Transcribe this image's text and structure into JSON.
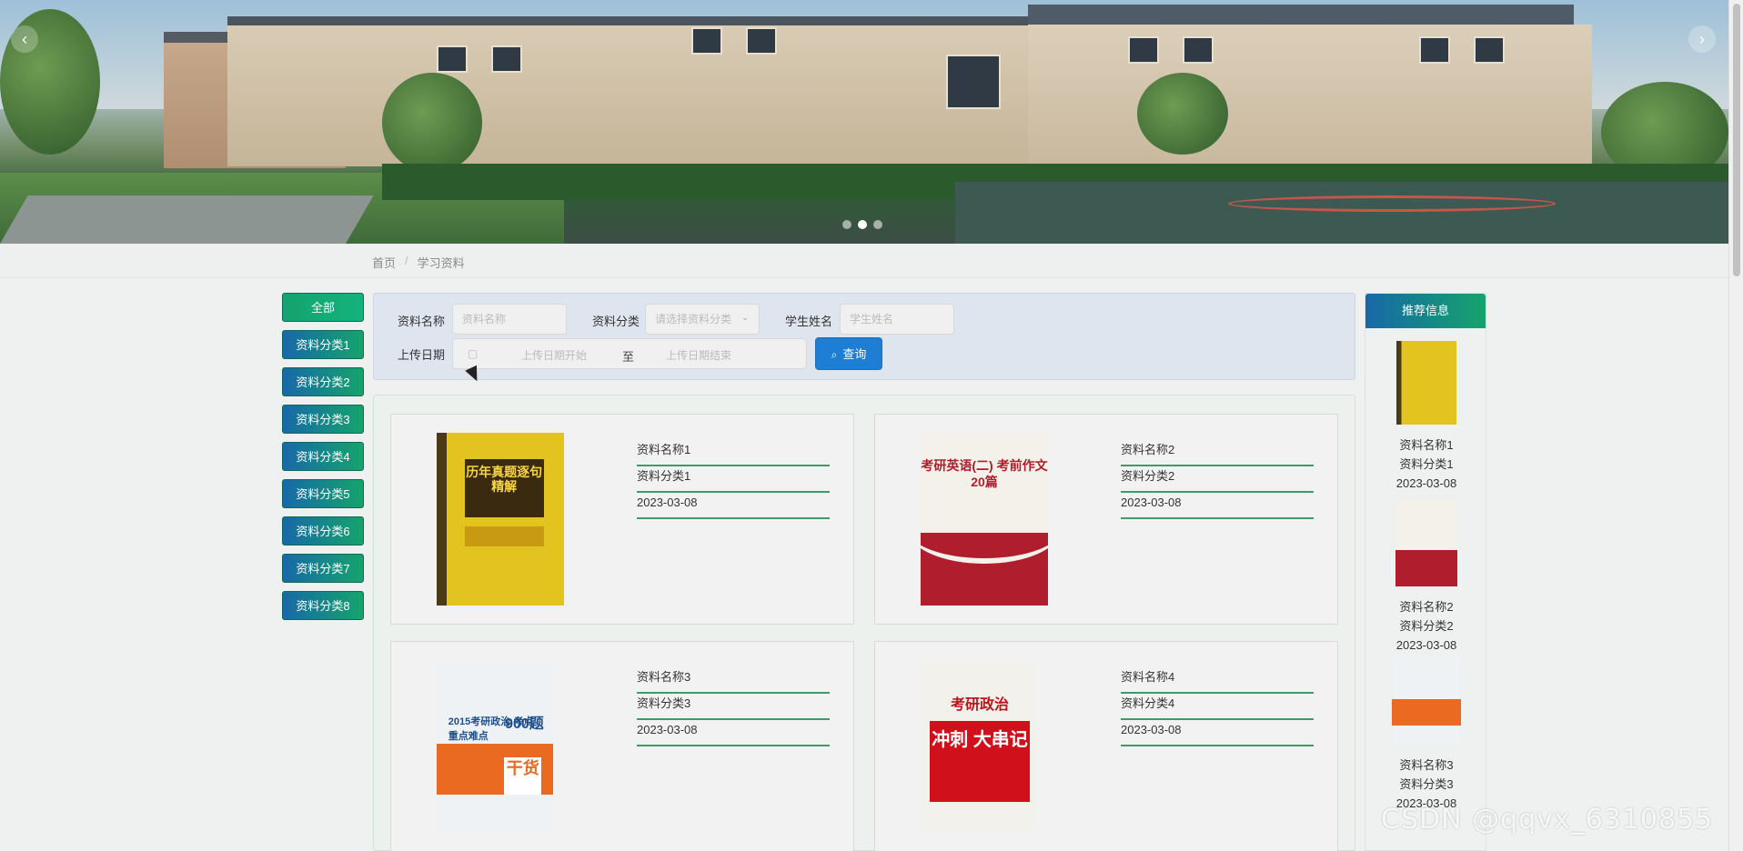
{
  "breadcrumb": {
    "home": "首页",
    "sep": "/",
    "current": "学习资料"
  },
  "categories": [
    "全部",
    "资料分类1",
    "资料分类2",
    "资料分类3",
    "资料分类4",
    "资料分类5",
    "资料分类6",
    "资料分类7",
    "资料分类8"
  ],
  "search": {
    "name_label": "资料名称",
    "name_placeholder": "资料名称",
    "category_label": "资料分类",
    "category_placeholder": "请选择资料分类",
    "student_label": "学生姓名",
    "student_placeholder": "学生姓名",
    "date_label": "上传日期",
    "date_start_placeholder": "上传日期开始",
    "date_to": "至",
    "date_end_placeholder": "上传日期结束",
    "button_label": "查询"
  },
  "items": [
    {
      "name": "资料名称1",
      "category": "资料分类1",
      "date": "2023-03-08",
      "cover_title": "历年真题逐句精解"
    },
    {
      "name": "资料名称2",
      "category": "资料分类2",
      "date": "2023-03-08",
      "cover_title": "考研英语(二) 考前作文20篇"
    },
    {
      "name": "资料名称3",
      "category": "资料分类3",
      "date": "2023-03-08",
      "cover_title": "2015考研政治 考点重点难点",
      "cover_extra": "900题",
      "cover_badge": "干货"
    },
    {
      "name": "资料名称4",
      "category": "资料分类4",
      "date": "2023-03-08",
      "cover_title": "考研政治",
      "cover_extra": "冲刺 大串记"
    }
  ],
  "recommend": {
    "title": "推荐信息",
    "items": [
      {
        "name": "资料名称1",
        "category": "资料分类1",
        "date": "2023-03-08"
      },
      {
        "name": "资料名称2",
        "category": "资料分类2",
        "date": "2023-03-08"
      },
      {
        "name": "资料名称3",
        "category": "资料分类3",
        "date": "2023-03-08"
      }
    ]
  },
  "watermark": "CSDN @qqvx_6310855",
  "colors": {
    "accent_blue": "#1769a8",
    "accent_green": "#16a36b",
    "button": "#1e7ed4",
    "underline": "#3e9b6a"
  }
}
